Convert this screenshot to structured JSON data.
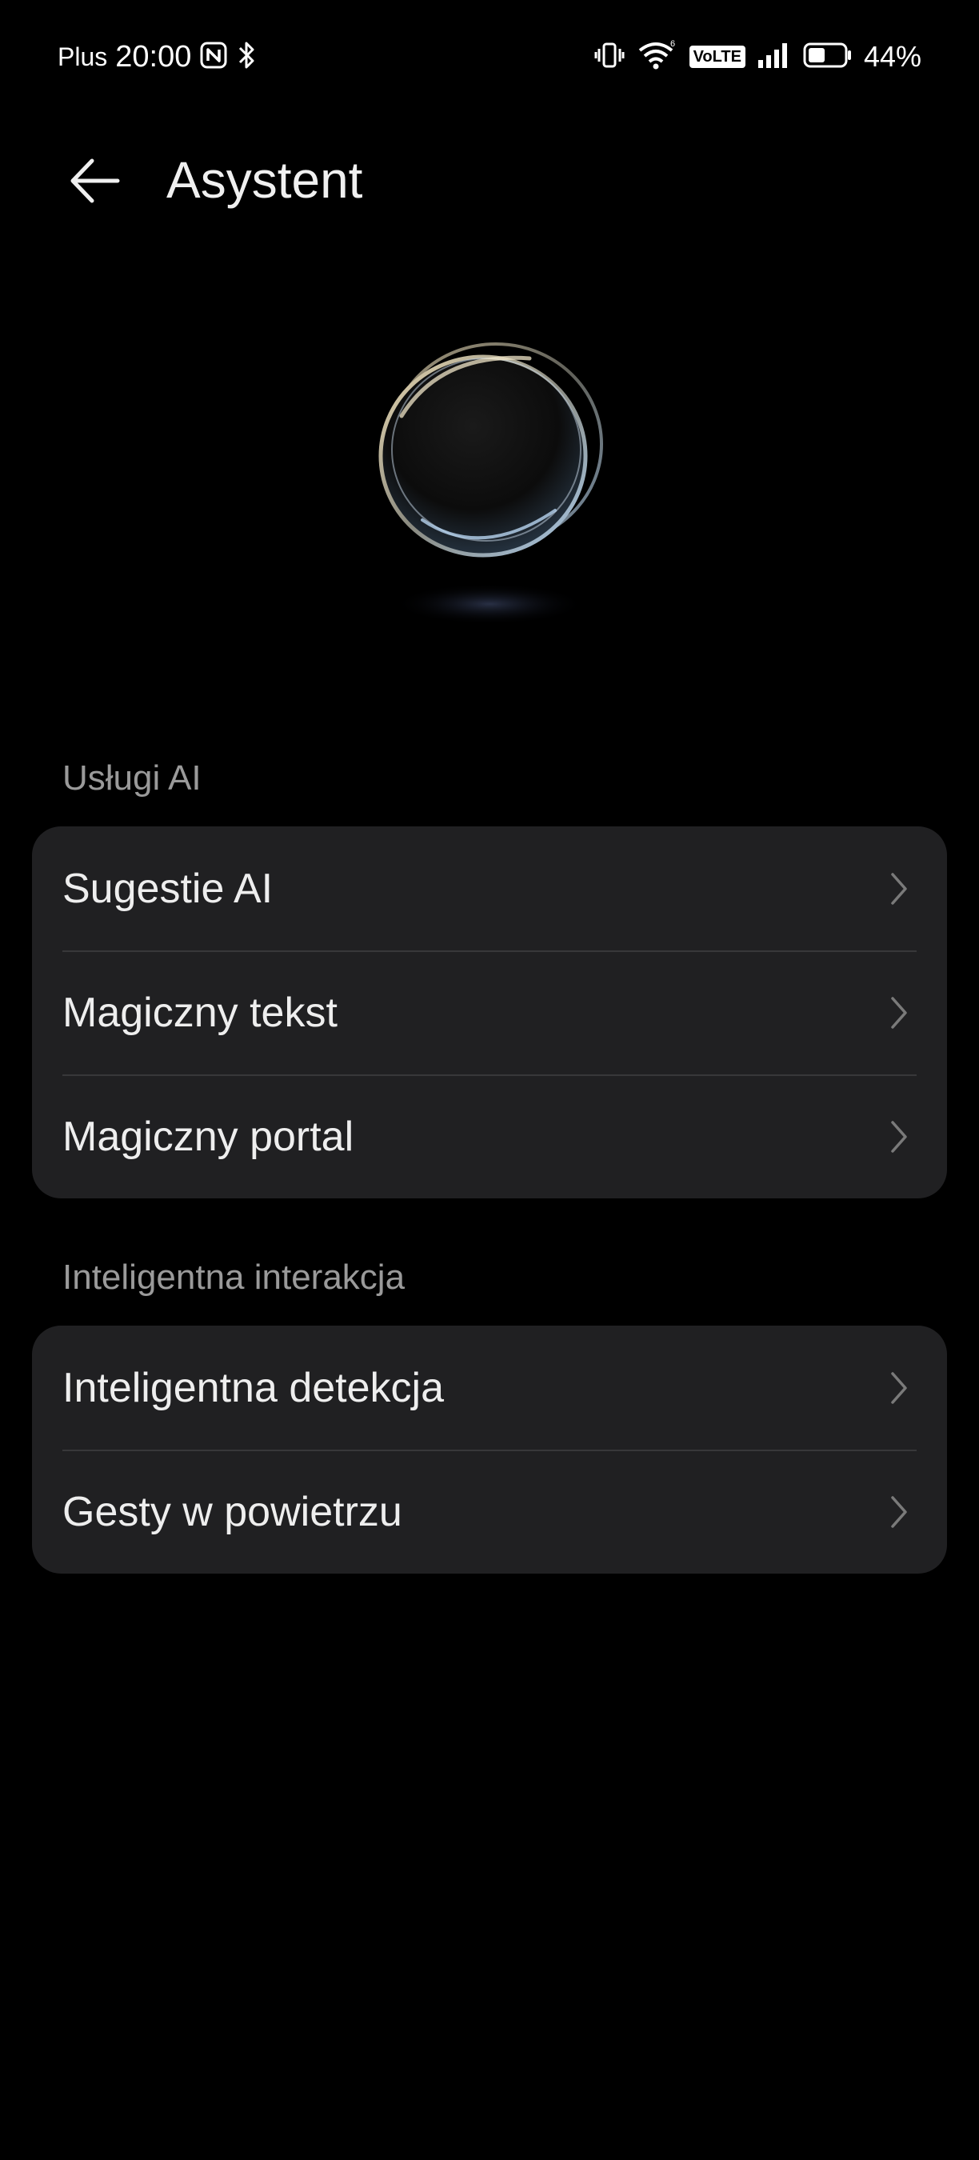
{
  "status_bar": {
    "carrier": "Plus",
    "time": "20:00",
    "volte": "VoLTE",
    "battery_percent": "44%",
    "icons": [
      "nfc-icon",
      "bluetooth-icon",
      "vibrate-icon",
      "wifi-icon",
      "volte-icon",
      "signal-icon",
      "battery-icon"
    ]
  },
  "header": {
    "title": "Asystent",
    "back_icon": "arrow-left-icon"
  },
  "sections": [
    {
      "label": "Usługi AI",
      "items": [
        {
          "label": "Sugestie AI"
        },
        {
          "label": "Magiczny tekst"
        },
        {
          "label": "Magiczny portal"
        }
      ]
    },
    {
      "label": "Inteligentna interakcja",
      "items": [
        {
          "label": "Inteligentna detekcja"
        },
        {
          "label": "Gesty w powietrzu"
        }
      ]
    }
  ],
  "colors": {
    "background": "#000000",
    "card": "#202022",
    "text_primary": "#eeeeee",
    "text_secondary": "#9a9a9a",
    "chevron": "#7a7a7a"
  }
}
